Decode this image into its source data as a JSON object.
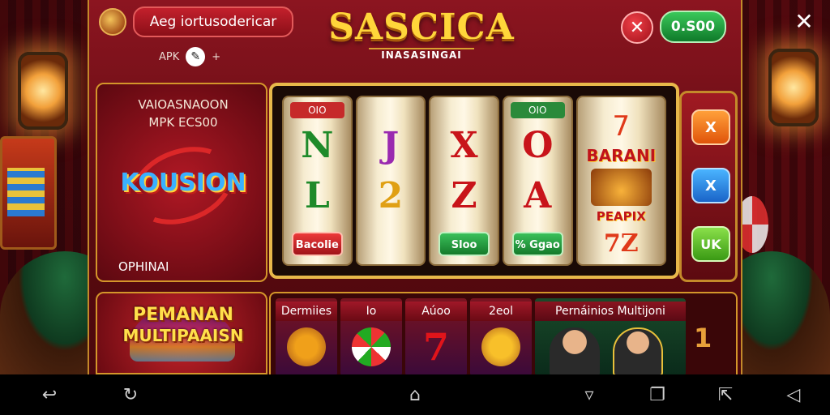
{
  "header": {
    "title_pill": "Aeg iortusodericar",
    "apk_label": "APK",
    "plus_label": "+",
    "logo_title": "SASCICA",
    "logo_subtitle": "INASASINGAI",
    "close_symbol": "✕",
    "balance": "0.S00"
  },
  "promo": {
    "line1": "VAIOASNAOON",
    "line2": "MPK ECS00",
    "logo_text": "KOUSION",
    "bottom_text": "OPHINAI"
  },
  "reels": [
    {
      "tag": "OIO",
      "symbols": [
        "N",
        "L"
      ],
      "button": "Bacolie",
      "button_color": "red",
      "symbol_color": "#1f8a2a"
    },
    {
      "tag": "",
      "symbols": [
        "J",
        "2"
      ],
      "button": "",
      "button_color": "",
      "symbol_color": "#9a2ab0"
    },
    {
      "tag": "",
      "symbols": [
        "X",
        "Z"
      ],
      "button": "Sloo",
      "button_color": "green",
      "symbol_color": "#c8141a"
    },
    {
      "tag": "OIO",
      "symbols": [
        "O",
        "A"
      ],
      "button": "% Ggao",
      "button_color": "green",
      "symbol_color": "#c8141a"
    }
  ],
  "bonus_reel": {
    "top_symbol": "7",
    "label": "BARANI",
    "sub_label": "PEAPIX",
    "bottom_symbol": "7Z"
  },
  "controls": {
    "orange_label": "X",
    "blue_label": "X",
    "green_label": "UK"
  },
  "multiplayer": {
    "line1": "PEMANAN",
    "line2": "MULTIPAAISN"
  },
  "games": [
    {
      "label": "Dermiies"
    },
    {
      "label": "Io"
    },
    {
      "label": "Aúoo"
    },
    {
      "label": "2eol"
    }
  ],
  "games_wide": {
    "label": "Pernáinios Multijoni"
  },
  "games_more_digit": "1",
  "colors": {
    "panel_red": "#8c1520",
    "gold_border": "#e8b84a",
    "balance_green": "#3ac85a",
    "close_red": "#f04048"
  },
  "navbar": {
    "back_icon": "back-arrow",
    "home_icon": "home",
    "recents_icon": "recents"
  }
}
